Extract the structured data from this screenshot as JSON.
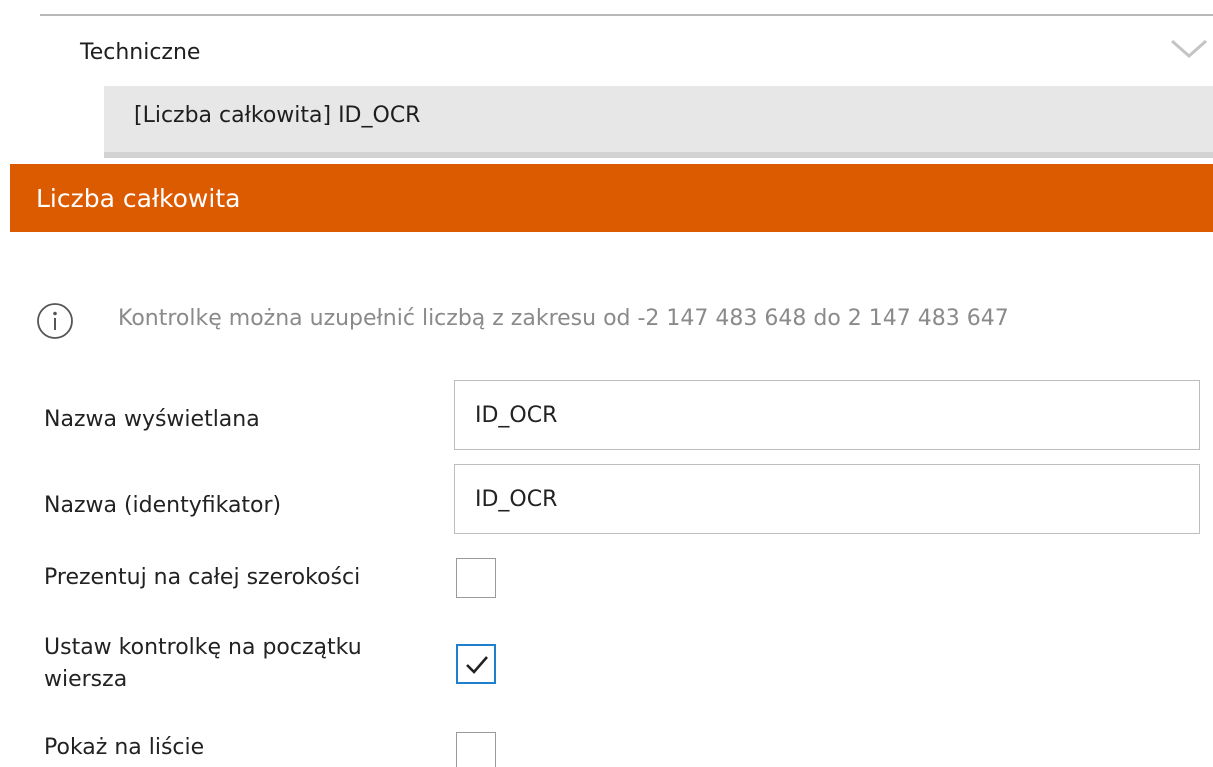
{
  "section": {
    "title": "Techniczne"
  },
  "selected_field": {
    "label": "[Liczba całkowita] ID_OCR"
  },
  "panel": {
    "title": "Liczba całkowita",
    "accent_color": "#dc5a00"
  },
  "info": {
    "icon": "info-icon",
    "text": "Kontrolkę można uzupełnić liczbą z zakresu od -2 147 483 648 do 2 147 483 647"
  },
  "form": {
    "display_name": {
      "label": "Nazwa wyświetlana",
      "value": "ID_OCR"
    },
    "identifier": {
      "label": "Nazwa (identyfikator)",
      "value": "ID_OCR"
    },
    "full_width": {
      "label": "Prezentuj na całej szerokości",
      "checked": false
    },
    "row_start": {
      "label_line1": "Ustaw kontrolkę na początku",
      "label_line2": "wiersza",
      "checked": true
    },
    "show_on_list": {
      "label": "Pokaż na liście",
      "checked": false
    }
  }
}
